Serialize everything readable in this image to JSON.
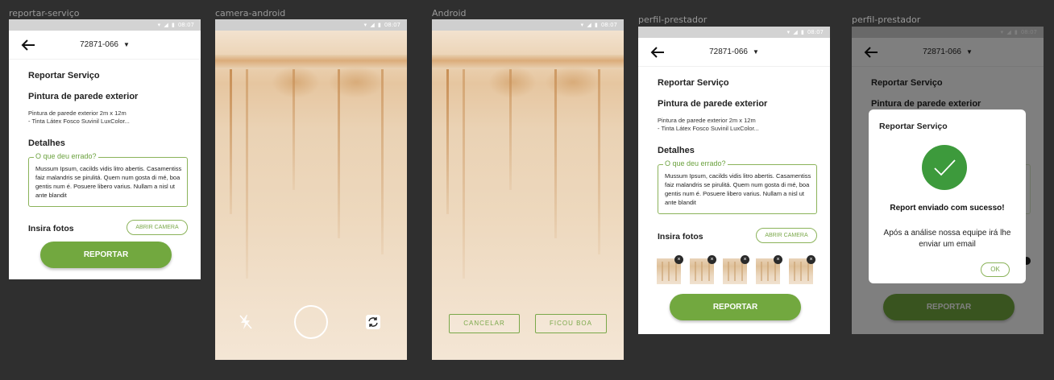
{
  "frames": [
    {
      "label": "reportar-serviço"
    },
    {
      "label": "camera-android"
    },
    {
      "label": "Android"
    },
    {
      "label": "perfil-prestador"
    },
    {
      "label": "perfil-prestador"
    }
  ],
  "status_bar": {
    "time": "08:07",
    "icons": "▾ ◢ ▮"
  },
  "app_bar": {
    "location": "72871-066",
    "caret": "▼"
  },
  "report": {
    "title": "Reportar Serviço",
    "service_name": "Pintura de parede exterior",
    "service_desc_line1": "Pintura de parede exterior 2m x 12m",
    "service_desc_line2": "- Tinta Látex Fosco Suvinil LuxColor...",
    "details_heading": "Detalhes",
    "field_label": "O que deu errado?",
    "field_value": "Mussum Ipsum, cacilds vidis litro abertis. Casamentiss faiz malandris se pirulitá. Quem num gosta di mé, boa gentis num é. Posuere libero varius. Nullam a nisl ut ante blandit",
    "photos_heading": "Insira fotos",
    "open_camera": "ABRIR CAMERA",
    "submit": "REPORTAR"
  },
  "camera": {
    "flash_icon": "flash-off-icon",
    "switch_icon": "switch-camera-icon",
    "cancel": "CANCELAR",
    "confirm": "FICOU BOA"
  },
  "photos": {
    "count": 5,
    "remove": "×"
  },
  "dialog": {
    "title": "Reportar Serviço",
    "headline": "Report enviado com sucesso!",
    "message": "Após a análise nossa equipe irá lhe enviar um email",
    "ok": "OK"
  },
  "colors": {
    "accent": "#72a83f",
    "accent_dark": "#3b5520",
    "check": "#3d9a3c"
  }
}
